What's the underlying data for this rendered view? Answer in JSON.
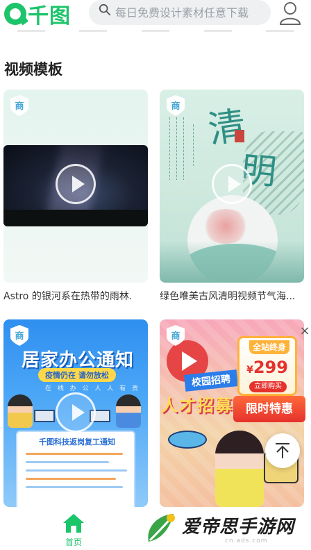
{
  "header": {
    "logo_text": "千图",
    "search_placeholder": "每日免费设计素材任意下载"
  },
  "section": {
    "title": "视频模板"
  },
  "cards": [
    {
      "badge": "商",
      "title": "Astro 的银河系在热带的雨林."
    },
    {
      "badge": "商",
      "title": "绿色唯美古风清明视频节气海...",
      "art_title_1": "清",
      "art_title_2": "明"
    },
    {
      "badge": "商",
      "art_title": "居家办公通知",
      "art_pill": "疫情仍在 请勿放松",
      "art_sub": "在 线 办 公 人 人 有 责",
      "art_notice": "千图科技返岗复工通知"
    },
    {
      "badge": "商",
      "art_tag": "校园招聘",
      "art_big": "人才招募令"
    }
  ],
  "promo": {
    "top": "全站终身",
    "currency": "¥",
    "price": "299",
    "buy": "立即购买",
    "ribbon": "限时特惠",
    "close": "×"
  },
  "bottom_nav": {
    "home_label": "首页"
  },
  "watermark": {
    "text": "爱帝思手游网",
    "url": "cn.ads.com"
  },
  "colors": {
    "brand": "#1cc46a",
    "badge": "#4aa8d8",
    "promo_red": "#e5322d"
  }
}
